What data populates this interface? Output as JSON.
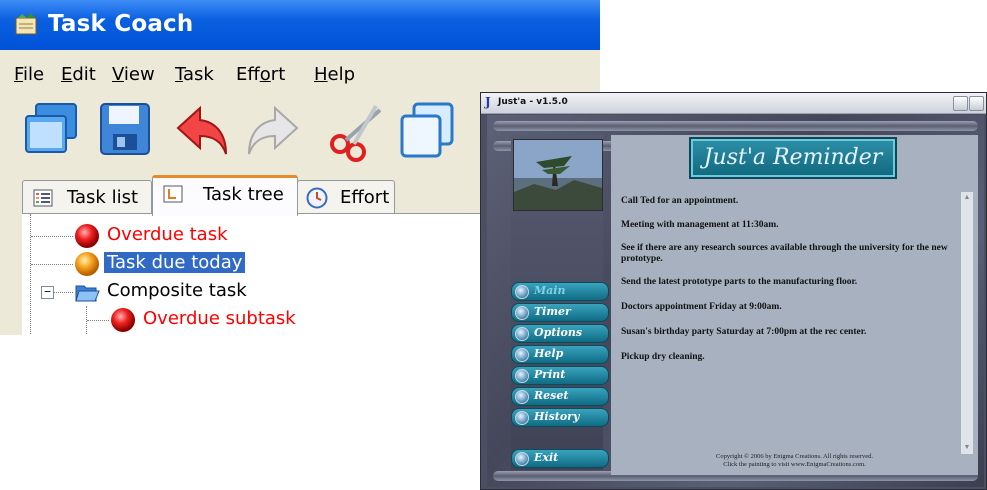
{
  "task_coach": {
    "title": "Task Coach",
    "menu": [
      {
        "key": "F",
        "rest": "ile"
      },
      {
        "key": "E",
        "rest": "dit"
      },
      {
        "key": "V",
        "rest": "iew"
      },
      {
        "key": "T",
        "rest": "ask"
      },
      {
        "pre": "Eff",
        "key": "o",
        "rest": "rt"
      },
      {
        "key": "H",
        "rest": "elp"
      }
    ],
    "toolbar_icons": [
      "open-icon",
      "save-icon",
      "undo-icon",
      "redo-icon",
      "cut-icon",
      "copy-icon"
    ],
    "tabs": [
      {
        "label": "Task list",
        "icon": "task-list-icon",
        "active": false
      },
      {
        "label": "Task tree",
        "icon": "task-tree-icon",
        "active": true
      },
      {
        "label": "Effort",
        "icon": "clock-icon",
        "active": false
      }
    ],
    "tree": [
      {
        "label": "Overdue task",
        "status": "overdue",
        "icon": "red-ball-icon"
      },
      {
        "label": "Task due today",
        "status": "due-today",
        "icon": "orange-ball-icon",
        "selected": true
      },
      {
        "label": "Composite task",
        "status": "normal",
        "icon": "folder-icon",
        "expanded": true
      },
      {
        "label": "Overdue subtask",
        "status": "overdue",
        "icon": "red-ball-icon"
      }
    ],
    "colors": {
      "overdue": "#ff0000",
      "selection": "#316ac5",
      "titlebar": "#0a5fe0"
    }
  },
  "justa": {
    "window_title": "Just'a - v1.5.0",
    "logo_glyph": "J",
    "banner": "Just'a Reminder",
    "reminders": [
      "Call Ted for an appointment.",
      "Meeting with management at 11:30am.",
      "See if there are any research sources available through the university for the new prototype.",
      "Send the latest prototype parts to the manufacturing floor.",
      "Doctors appointment Friday at 9:00am.",
      "Susan's birthday party Saturday at 7:00pm at the rec center.",
      "Pickup dry cleaning."
    ],
    "buttons": [
      "Main",
      "Timer",
      "Options",
      "Help",
      "Print",
      "Reset",
      "History"
    ],
    "exit_button": "Exit",
    "copyright_line1": "Copyright © 2006 by Enigma Creations. All rights reserved.",
    "copyright_line2": "Click the painting to visit www.EnigmaCreations.com.",
    "colors": {
      "panel": "#a7b1bf",
      "button": "#1f8aa4",
      "frame": "#4c4f63"
    }
  }
}
